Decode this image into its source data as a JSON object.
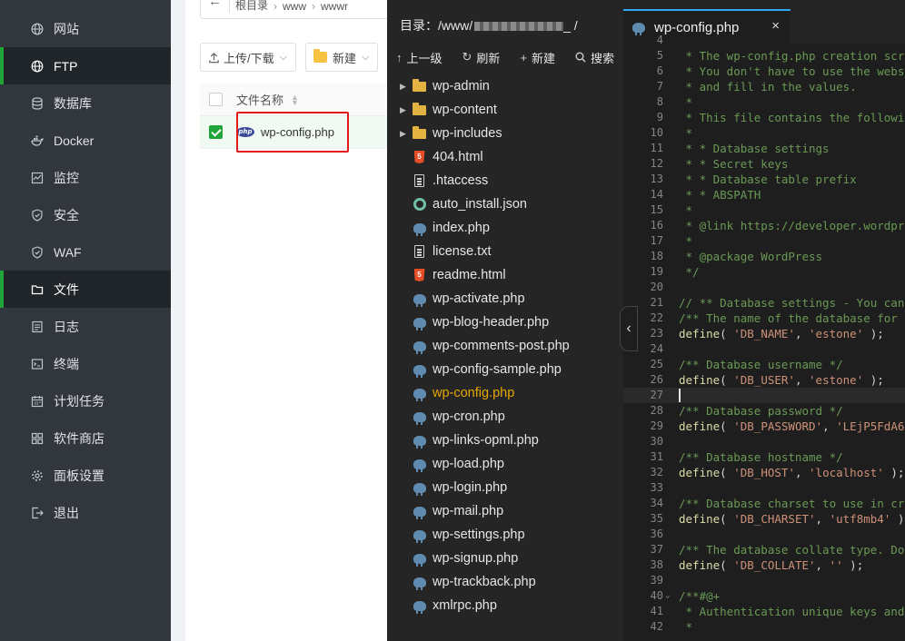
{
  "sidebar": {
    "items": [
      {
        "label": "网站",
        "icon": "globe-icon"
      },
      {
        "label": "FTP",
        "icon": "globe-icon",
        "active": true
      },
      {
        "label": "数据库",
        "icon": "database-icon"
      },
      {
        "label": "Docker",
        "icon": "docker-icon"
      },
      {
        "label": "监控",
        "icon": "monitor-icon"
      },
      {
        "label": "安全",
        "icon": "shield-icon"
      },
      {
        "label": "WAF",
        "icon": "shield-icon"
      },
      {
        "label": "文件",
        "icon": "folder-icon",
        "active": true
      },
      {
        "label": "日志",
        "icon": "log-icon"
      },
      {
        "label": "终端",
        "icon": "terminal-icon"
      },
      {
        "label": "计划任务",
        "icon": "calendar-icon"
      },
      {
        "label": "软件商店",
        "icon": "grid-icon"
      },
      {
        "label": "面板设置",
        "icon": "gear-icon"
      },
      {
        "label": "退出",
        "icon": "logout-icon"
      }
    ]
  },
  "filemgr": {
    "breadcrumb": [
      "根目录",
      "www",
      "wwwr"
    ],
    "upload_label": "上传/下载",
    "new_label": "新建",
    "column_name": "文件名称",
    "file_row": {
      "name": "wp-config.php",
      "checked": true
    }
  },
  "editor": {
    "dir_label": "目录：/www/",
    "dir_suffix": "_ /",
    "toolbar": [
      {
        "label": "上一级",
        "icon": "arrow-up-icon"
      },
      {
        "label": "刷新",
        "icon": "refresh-icon"
      },
      {
        "label": "新建",
        "icon": "plus-icon"
      },
      {
        "label": "搜索",
        "icon": "search-icon"
      }
    ],
    "tree": [
      {
        "name": "wp-admin",
        "type": "folder"
      },
      {
        "name": "wp-content",
        "type": "folder"
      },
      {
        "name": "wp-includes",
        "type": "folder"
      },
      {
        "name": "404.html",
        "type": "html"
      },
      {
        "name": ".htaccess",
        "type": "doc"
      },
      {
        "name": "auto_install.json",
        "type": "json"
      },
      {
        "name": "index.php",
        "type": "php"
      },
      {
        "name": "license.txt",
        "type": "doc"
      },
      {
        "name": "readme.html",
        "type": "html"
      },
      {
        "name": "wp-activate.php",
        "type": "php"
      },
      {
        "name": "wp-blog-header.php",
        "type": "php"
      },
      {
        "name": "wp-comments-post.php",
        "type": "php"
      },
      {
        "name": "wp-config-sample.php",
        "type": "php"
      },
      {
        "name": "wp-config.php",
        "type": "php",
        "selected": true
      },
      {
        "name": "wp-cron.php",
        "type": "php"
      },
      {
        "name": "wp-links-opml.php",
        "type": "php"
      },
      {
        "name": "wp-load.php",
        "type": "php"
      },
      {
        "name": "wp-login.php",
        "type": "php"
      },
      {
        "name": "wp-mail.php",
        "type": "php"
      },
      {
        "name": "wp-settings.php",
        "type": "php"
      },
      {
        "name": "wp-signup.php",
        "type": "php"
      },
      {
        "name": "wp-trackback.php",
        "type": "php"
      },
      {
        "name": "xmlrpc.php",
        "type": "php"
      }
    ],
    "tab_title": "wp-config.php",
    "tab_close": "×",
    "collapse_glyph": "‹",
    "code_lines": [
      {
        "n": "4",
        "kind": "comment",
        "text": ""
      },
      {
        "n": "5",
        "kind": "comment",
        "text": " * The wp-config.php creation scr"
      },
      {
        "n": "6",
        "kind": "comment",
        "text": " * You don't have to use the webs"
      },
      {
        "n": "7",
        "kind": "comment",
        "text": " * and fill in the values."
      },
      {
        "n": "8",
        "kind": "comment",
        "text": " *"
      },
      {
        "n": "9",
        "kind": "comment",
        "text": " * This file contains the followi"
      },
      {
        "n": "10",
        "kind": "comment",
        "text": " *"
      },
      {
        "n": "11",
        "kind": "comment",
        "text": " * * Database settings"
      },
      {
        "n": "12",
        "kind": "comment",
        "text": " * * Secret keys"
      },
      {
        "n": "13",
        "kind": "comment",
        "text": " * * Database table prefix"
      },
      {
        "n": "14",
        "kind": "comment",
        "text": " * * ABSPATH"
      },
      {
        "n": "15",
        "kind": "comment",
        "text": " *"
      },
      {
        "n": "16",
        "kind": "comment",
        "text": " * @link https://developer.wordpr"
      },
      {
        "n": "17",
        "kind": "comment",
        "text": " *"
      },
      {
        "n": "18",
        "kind": "comment",
        "text": " * @package WordPress"
      },
      {
        "n": "19",
        "kind": "comment",
        "text": " */"
      },
      {
        "n": "20",
        "kind": "code",
        "text": ""
      },
      {
        "n": "21",
        "kind": "comment",
        "text": "// ** Database settings - You can"
      },
      {
        "n": "22",
        "kind": "comment",
        "text": "/** The name of the database for"
      },
      {
        "n": "23",
        "kind": "define",
        "fn": "define",
        "key": "'DB_NAME'",
        "val": "'estone'",
        "tail": " );"
      },
      {
        "n": "24",
        "kind": "code",
        "text": ""
      },
      {
        "n": "25",
        "kind": "comment",
        "text": "/** Database username */"
      },
      {
        "n": "26",
        "kind": "define",
        "fn": "define",
        "key": "'DB_USER'",
        "val": "'estone'",
        "tail": " );"
      },
      {
        "n": "27",
        "kind": "code",
        "text": "",
        "current": true
      },
      {
        "n": "28",
        "kind": "comment",
        "text": "/** Database password */"
      },
      {
        "n": "29",
        "kind": "define",
        "fn": "define",
        "key": "'DB_PASSWORD'",
        "val": "'LEjP5FdA6",
        "tail": ""
      },
      {
        "n": "30",
        "kind": "code",
        "text": ""
      },
      {
        "n": "31",
        "kind": "comment",
        "text": "/** Database hostname */"
      },
      {
        "n": "32",
        "kind": "define",
        "fn": "define",
        "key": "'DB_HOST'",
        "val": "'localhost'",
        "tail": " );"
      },
      {
        "n": "33",
        "kind": "code",
        "text": ""
      },
      {
        "n": "34",
        "kind": "comment",
        "text": "/** Database charset to use in cr"
      },
      {
        "n": "35",
        "kind": "define",
        "fn": "define",
        "key": "'DB_CHARSET'",
        "val": "'utf8mb4'",
        "tail": " );"
      },
      {
        "n": "36",
        "kind": "code",
        "text": ""
      },
      {
        "n": "37",
        "kind": "comment",
        "text": "/** The database collate type. Do"
      },
      {
        "n": "38",
        "kind": "define",
        "fn": "define",
        "key": "'DB_COLLATE'",
        "val": "''",
        "tail": " );"
      },
      {
        "n": "39",
        "kind": "code",
        "text": ""
      },
      {
        "n": "40",
        "kind": "comment",
        "text": "/**#@+",
        "fold": true
      },
      {
        "n": "41",
        "kind": "comment",
        "text": " * Authentication unique keys and"
      },
      {
        "n": "42",
        "kind": "comment",
        "text": " *"
      }
    ]
  },
  "colors": {
    "accent_green": "#20a53a",
    "highlight_red": "#e21a1a",
    "selected_file": "#e5a800",
    "tab_accent": "#2ea8f0"
  }
}
